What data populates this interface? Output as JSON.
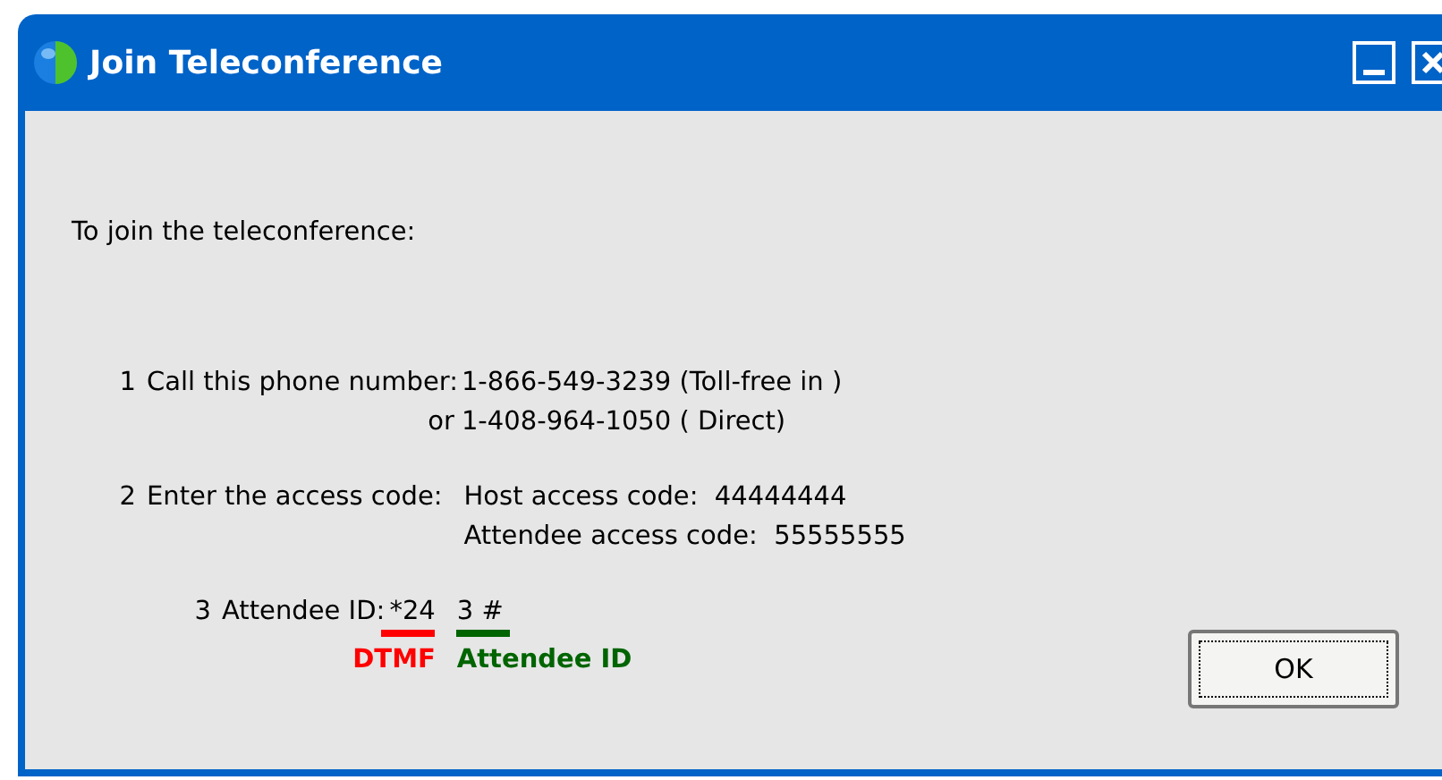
{
  "window": {
    "title": "Join Teleconference"
  },
  "intro": "To join the teleconference:",
  "steps": [
    {
      "kind": "phone",
      "number": "1",
      "label": "Call this phone number:",
      "lines": [
        {
          "text": "1-866-549-3239 (Toll-free in )"
        },
        {
          "prefix": "or",
          "text": "1-408-964-1050 ( Direct)"
        }
      ]
    },
    {
      "kind": "codes",
      "number": "2",
      "label": "Enter the access code:",
      "lines": [
        {
          "text": "Host access code:  44444444"
        },
        {
          "text": "Attendee access code:  55555555"
        }
      ]
    },
    {
      "kind": "id",
      "number": "3",
      "label": "Attendee ID:",
      "segments": [
        {
          "text": "*24",
          "caption": "DTMF",
          "color": "#ff0000"
        },
        {
          "text": "3 #",
          "caption": "Attendee ID",
          "color": "#006400"
        }
      ]
    }
  ],
  "buttons": [
    "OK"
  ]
}
